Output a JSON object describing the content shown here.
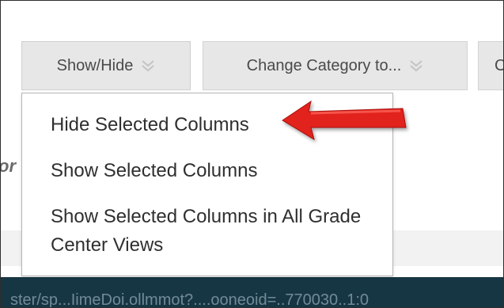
{
  "toolbar": {
    "show_hide_label": "Show/Hide",
    "change_category_label": "Change Category to...",
    "edge_fragment": "C"
  },
  "dropdown": {
    "items": [
      {
        "label": "Hide Selected Columns"
      },
      {
        "label": "Show Selected Columns"
      },
      {
        "label": "Show Selected Columns in All Grade Center Views"
      }
    ]
  },
  "background": {
    "left_fragment": "or",
    "bottom_bar_text": "ster/sp...IimeDoi.ollmmot?....ooneoid=..770030..1:0"
  },
  "icons": {
    "chevron": "double-chevron-down-icon",
    "annotation": "red-pointer-arrow"
  },
  "colors": {
    "button_bg": "#e7e7e7",
    "dark_bar": "#173644",
    "arrow_red": "#e2231a"
  }
}
